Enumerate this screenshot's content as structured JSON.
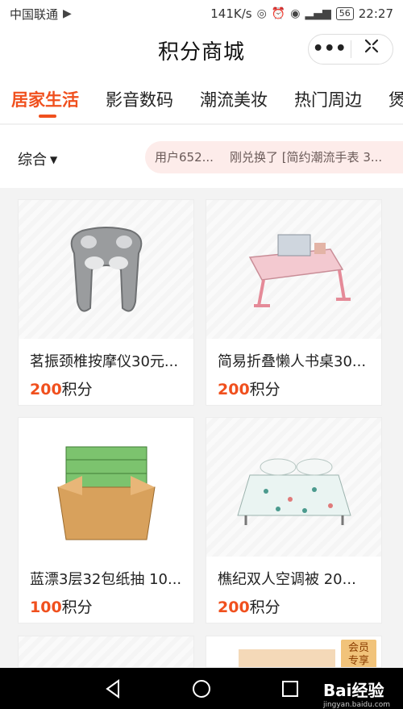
{
  "status_bar": {
    "carrier": "中国联通",
    "speed": "141K/s",
    "battery": "56",
    "time": "22:27"
  },
  "title_bar": {
    "title": "积分商城",
    "more_icon": "more-dots-icon",
    "close_icon": "close-target-icon"
  },
  "tabs": [
    {
      "label": "居家生活",
      "active": true
    },
    {
      "label": "影音数码",
      "active": false
    },
    {
      "label": "潮流美妆",
      "active": false
    },
    {
      "label": "热门周边",
      "active": false
    },
    {
      "label": "煲",
      "active": false
    }
  ],
  "filter": {
    "sort_label": "综合",
    "ticker_user": "用户652...",
    "ticker_text": "刚兑换了 [简约潮流手表 3..."
  },
  "products": [
    {
      "name": "茗振颈椎按摩仪30元...",
      "price": "200",
      "unit": "积分"
    },
    {
      "name": "简易折叠懒人书桌30...",
      "price": "200",
      "unit": "积分"
    },
    {
      "name": "蓝漂3层32包纸抽 10...",
      "price": "100",
      "unit": "积分"
    },
    {
      "name": "樵纪双人空调被 20...",
      "price": "200",
      "unit": "积分"
    }
  ],
  "partial_card_badge": {
    "line1": "会员",
    "line2": "专享"
  },
  "watermark": {
    "brand": "Bai经验",
    "site": "jingyan.baidu.com"
  },
  "colors": {
    "accent": "#f0501e",
    "ticker_bg": "#fdecea"
  }
}
